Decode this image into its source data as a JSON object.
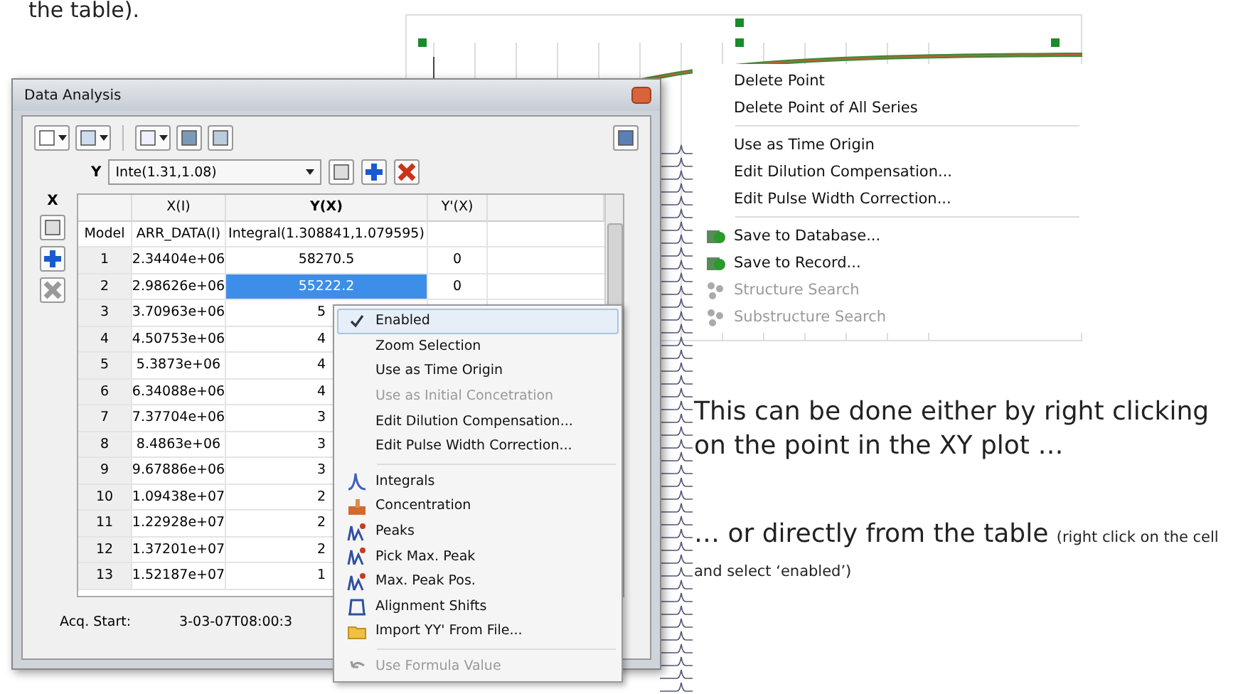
{
  "heading_fragment": "the table).",
  "window": {
    "title": "Data Analysis",
    "y_selector": {
      "label": "Y",
      "value": "Inte(1.31,1.08)"
    },
    "x_label": "X",
    "table": {
      "columns": [
        "",
        "X(I)",
        "Y(X)",
        "Y'(X)"
      ],
      "rows": [
        {
          "cells": [
            "Model",
            "ARR_DATA(I)",
            "Integral(1.308841,1.079595)",
            ""
          ],
          "selected": false
        },
        {
          "cells": [
            "1",
            "2.34404e+06",
            "58270.5",
            "0"
          ],
          "selected": false
        },
        {
          "cells": [
            "2",
            "2.98626e+06",
            "55222.2",
            "0"
          ],
          "selected": true
        },
        {
          "cells": [
            "3",
            "3.70963e+06",
            "5",
            ""
          ],
          "selected": false
        },
        {
          "cells": [
            "4",
            "4.50753e+06",
            "4",
            ""
          ],
          "selected": false
        },
        {
          "cells": [
            "5",
            "5.3873e+06",
            "4",
            ""
          ],
          "selected": false
        },
        {
          "cells": [
            "6",
            "6.34088e+06",
            "4",
            ""
          ],
          "selected": false
        },
        {
          "cells": [
            "7",
            "7.37704e+06",
            "3",
            ""
          ],
          "selected": false
        },
        {
          "cells": [
            "8",
            "8.4863e+06",
            "3",
            ""
          ],
          "selected": false
        },
        {
          "cells": [
            "9",
            "9.67886e+06",
            "3",
            ""
          ],
          "selected": false
        },
        {
          "cells": [
            "10",
            "1.09438e+07",
            "2",
            ""
          ],
          "selected": false
        },
        {
          "cells": [
            "11",
            "1.22928e+07",
            "2",
            ""
          ],
          "selected": false
        },
        {
          "cells": [
            "12",
            "1.37201e+07",
            "2",
            ""
          ],
          "selected": false
        },
        {
          "cells": [
            "13",
            "1.52187e+07",
            "1",
            ""
          ],
          "selected": false
        }
      ]
    },
    "acq_start": {
      "label": "Acq. Start:",
      "value": "3-03-07T08:00:3"
    }
  },
  "table_menu": [
    {
      "kind": "item",
      "label": "Enabled",
      "checked": true,
      "disabled": false,
      "highlighted": true
    },
    {
      "kind": "item",
      "label": "Zoom Selection",
      "checked": false,
      "disabled": false,
      "highlighted": false
    },
    {
      "kind": "item",
      "label": "Use as Time Origin",
      "checked": false,
      "disabled": false,
      "highlighted": false
    },
    {
      "kind": "item",
      "label": "Use as Initial Concetration",
      "checked": false,
      "disabled": true,
      "highlighted": false
    },
    {
      "kind": "item",
      "label": "Edit Dilution Compensation...",
      "checked": false,
      "disabled": false,
      "highlighted": false
    },
    {
      "kind": "item",
      "label": "Edit Pulse Width Correction...",
      "checked": false,
      "disabled": false,
      "highlighted": false
    },
    {
      "kind": "separator"
    },
    {
      "kind": "item",
      "label": "Integrals",
      "checked": false,
      "disabled": false,
      "highlighted": false
    },
    {
      "kind": "item",
      "label": "Concentration",
      "checked": false,
      "disabled": false,
      "highlighted": false
    },
    {
      "kind": "item",
      "label": "Peaks",
      "checked": false,
      "disabled": false,
      "highlighted": false
    },
    {
      "kind": "item",
      "label": "Pick Max. Peak",
      "checked": false,
      "disabled": false,
      "highlighted": false
    },
    {
      "kind": "item",
      "label": "Max. Peak Pos.",
      "checked": false,
      "disabled": false,
      "highlighted": false
    },
    {
      "kind": "item",
      "label": "Alignment Shifts",
      "checked": false,
      "disabled": false,
      "highlighted": false
    },
    {
      "kind": "item",
      "label": "Import YY' From File...",
      "checked": false,
      "disabled": false,
      "highlighted": false
    },
    {
      "kind": "separator"
    },
    {
      "kind": "item",
      "label": "Use Formula Value",
      "checked": false,
      "disabled": true,
      "highlighted": false
    }
  ],
  "plot_menu": [
    {
      "kind": "item",
      "label": "Delete Point",
      "disabled": false
    },
    {
      "kind": "item",
      "label": "Delete Point of All Series",
      "disabled": false
    },
    {
      "kind": "separator"
    },
    {
      "kind": "item",
      "label": "Use as Time Origin",
      "disabled": false
    },
    {
      "kind": "item",
      "label": "Edit Dilution Compensation...",
      "disabled": false
    },
    {
      "kind": "item",
      "label": "Edit Pulse Width Correction...",
      "disabled": false
    },
    {
      "kind": "separator"
    },
    {
      "kind": "item",
      "label": "Save to Database...",
      "disabled": false
    },
    {
      "kind": "item",
      "label": "Save to Record...",
      "disabled": false
    },
    {
      "kind": "item",
      "label": "Structure Search",
      "disabled": true
    },
    {
      "kind": "item",
      "label": "Substructure Search",
      "disabled": true
    }
  ],
  "caption_1": "This can be done either by right clicking on the point in the XY plot …",
  "caption_2": {
    "main": "… or directly from the table",
    "note": "(right click on the cell and select ‘enabled’)"
  }
}
